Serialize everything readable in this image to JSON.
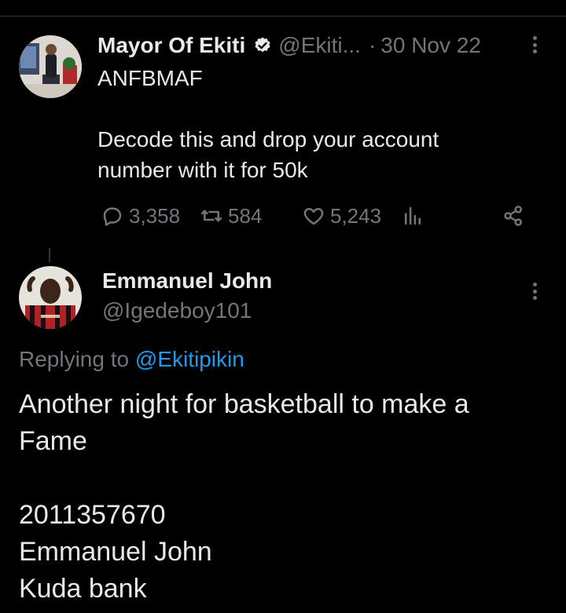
{
  "tweet1": {
    "author_name": "Mayor Of Ekiti",
    "author_handle": "@Ekiti...",
    "separator": "·",
    "date": "30 Nov 22",
    "lines": [
      "ANFBMAF",
      "Decode this and drop your account",
      "number with it for 50k"
    ],
    "stats": {
      "replies": "3,358",
      "retweets": "584",
      "likes": "5,243"
    },
    "icons": [
      "verified-badge-icon",
      "reply-icon",
      "retweet-icon",
      "like-icon",
      "analytics-icon",
      "share-icon",
      "more-icon"
    ],
    "verified_color": "#1d9bf0"
  },
  "tweet2": {
    "author_name": "Emmanuel John",
    "author_handle": "@Igedeboy101",
    "replying_prefix": "Replying to",
    "replying_to": "@Ekitipikin",
    "lines": [
      "Another night for basketball to make a",
      "Fame",
      "2011357670",
      "Emmanuel John",
      "Kuda bank"
    ]
  },
  "colors": {
    "background": "#000000",
    "text": "#e7e9ea",
    "muted": "#71767b",
    "accent": "#1d9bf0"
  }
}
